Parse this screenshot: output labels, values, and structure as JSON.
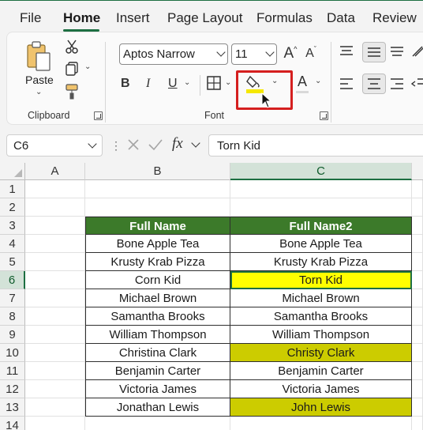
{
  "tabs": [
    "File",
    "Home",
    "Insert",
    "Page Layout",
    "Formulas",
    "Data",
    "Review"
  ],
  "active_tab": "Home",
  "ribbon": {
    "clipboard": {
      "paste_label": "Paste",
      "group_label": "Clipboard"
    },
    "font": {
      "font_name": "Aptos Narrow",
      "font_size": "11",
      "bold": "B",
      "italic": "I",
      "underline": "U",
      "font_color_glyph": "A",
      "group_label": "Font",
      "fill_color": "#f5e800"
    }
  },
  "formula_bar": {
    "name_box": "C6",
    "fx_label": "fx",
    "formula": "Torn Kid"
  },
  "grid": {
    "columns": [
      "A",
      "B",
      "C"
    ],
    "selected_column": "C",
    "row_numbers": [
      "1",
      "2",
      "3",
      "4",
      "5",
      "6",
      "7",
      "8",
      "9",
      "10",
      "11",
      "12",
      "13",
      "14"
    ],
    "selected_row": "6",
    "active_cell": "C6",
    "header_fill": "#3c7a2a",
    "headers": {
      "b": "Full Name",
      "c": "Full Name2"
    },
    "rows": [
      {
        "b": "Bone Apple Tea",
        "c": "Bone Apple Tea",
        "fill": ""
      },
      {
        "b": "Krusty Krab Pizza",
        "c": "Krusty Krab Pizza",
        "fill": ""
      },
      {
        "b": "Corn Kid",
        "c": "Torn Kid",
        "fill": "#ffff00"
      },
      {
        "b": "Michael Brown",
        "c": "Michael Brown",
        "fill": ""
      },
      {
        "b": "Samantha Brooks",
        "c": "Samantha Brooks",
        "fill": ""
      },
      {
        "b": "William Thompson",
        "c": "William Thompson",
        "fill": ""
      },
      {
        "b": "Christina Clark",
        "c": "Christy Clark",
        "fill": "#cccc00"
      },
      {
        "b": "Benjamin Carter",
        "c": "Benjamin Carter",
        "fill": ""
      },
      {
        "b": "Victoria James",
        "c": "Victoria James",
        "fill": ""
      },
      {
        "b": "Jonathan Lewis",
        "c": "John Lewis",
        "fill": "#cccc00"
      }
    ]
  }
}
